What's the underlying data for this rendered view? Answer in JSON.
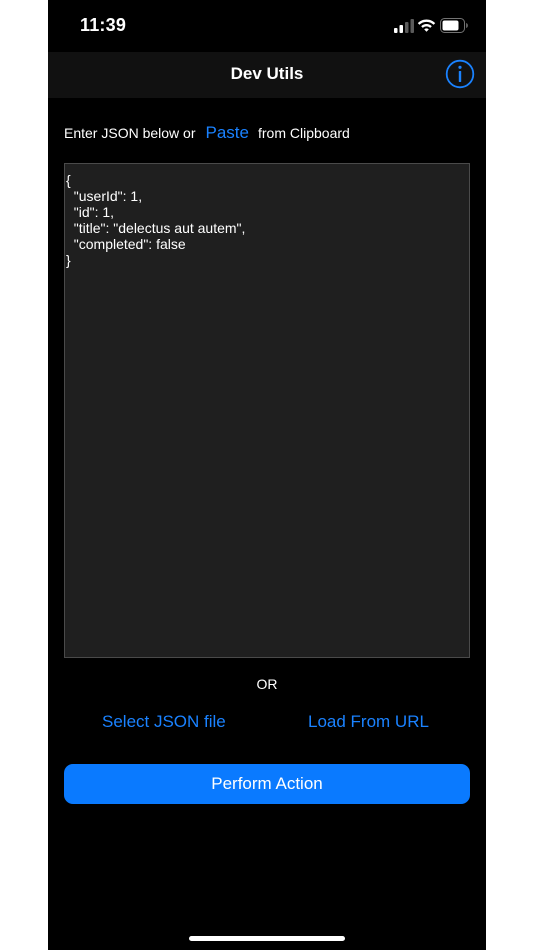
{
  "status_bar": {
    "time": "11:39",
    "icons": [
      "cellular-signal-icon",
      "wifi-icon",
      "battery-icon"
    ]
  },
  "nav": {
    "title": "Dev Utils",
    "info_icon": "info-circle-icon"
  },
  "prompt": {
    "before": "Enter JSON below or",
    "paste_label": "Paste",
    "after": "from Clipboard"
  },
  "editor": {
    "value": "{\n  \"userId\": 1,\n  \"id\": 1,\n  \"title\": \"delectus aut autem\",\n  \"completed\": false\n}"
  },
  "or_label": "OR",
  "actions": {
    "select_file_label": "Select JSON file",
    "load_url_label": "Load From URL",
    "perform_label": "Perform Action"
  },
  "colors": {
    "accent": "#0a7aff",
    "background": "#000000",
    "editor_background": "#1f1f1f"
  }
}
